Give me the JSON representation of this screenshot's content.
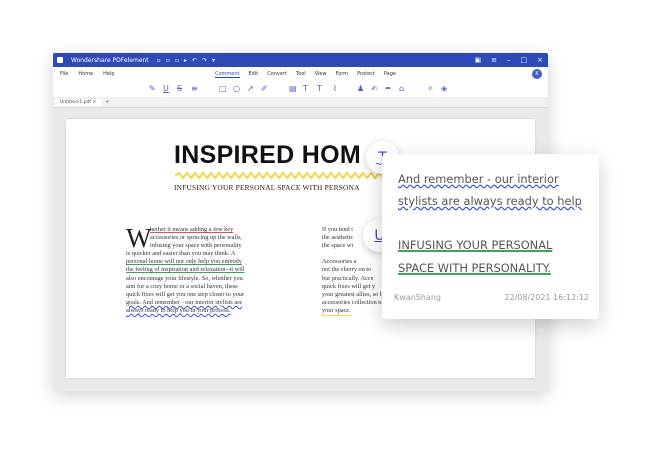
{
  "app": {
    "title": "Wondershare PDFelement"
  },
  "menus": {
    "left": [
      "File",
      "Home",
      "Help"
    ],
    "center": [
      "Comment",
      "Edit",
      "Convert",
      "Tool",
      "View",
      "Form",
      "Protect",
      "Page"
    ]
  },
  "tab": {
    "name": "Untitled-1.pdf",
    "close": "×",
    "add": "+"
  },
  "document": {
    "headline": "INSPIRED HOM",
    "subhead": "INFUSING YOUR PERSONAL SPACE WITH PERSONA",
    "dropcap": "W",
    "col1": [
      "hether it means adding a few key",
      "accessories or sprucing up the walls,",
      "infusing your space with personality",
      "is quicker and easier than you may think. A",
      "personal home will not only help you embody",
      "the feeling of inspiration and relaxation--it will",
      "also encourage your lifestyle. So, whether you",
      "aim for a cozy home or a social haven, these",
      "quick fixes will get you one step closer to your",
      "goals. And remember - our interior stylists are",
      "always ready to help you in your process."
    ],
    "col2": [
      "If you tend t",
      "the aesthetic",
      "the space wi",
      "",
      "Accessories a",
      "not the cherry on to",
      "but practically. Acce",
      "quick fixes will get y",
      "your greatest allies, so be sure to browse our",
      "accessories collection to find the perfect glue for",
      "your space."
    ]
  },
  "popup": {
    "line1": "And remember - our interior",
    "line2": "stylists are always ready to help",
    "line3": "INFUSING YOUR PERSONAL",
    "line4": "SPACE WITH PERSONALITY.",
    "author": "KwanShang",
    "time": "22/08/2021 16:12:12"
  },
  "badges": {
    "text_tool": "T",
    "underline_tool": "U"
  },
  "colors": {
    "brand": "#2e49b8",
    "accent": "#4a44c9",
    "zigzag": "#f5d94a",
    "green": "#3aa55b",
    "red": "#d9534f"
  }
}
